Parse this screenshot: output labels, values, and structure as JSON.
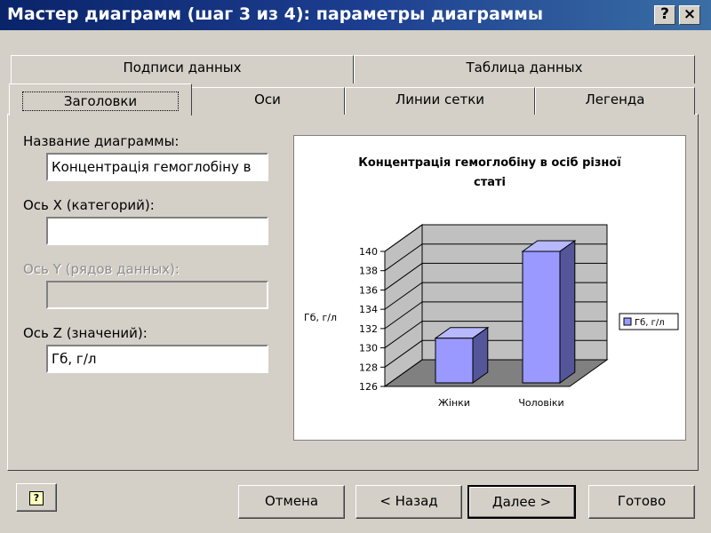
{
  "window": {
    "title": "Мастер диаграмм (шаг 3 из 4): параметры диаграммы",
    "help_label": "?",
    "close_label": "×",
    "title_color": "#0a246a"
  },
  "tabs": {
    "back_row": [
      {
        "label": "Подписи данных"
      },
      {
        "label": "Таблица данных"
      }
    ],
    "front_row": [
      {
        "label": "Заголовки",
        "active": true
      },
      {
        "label": "Оси"
      },
      {
        "label": "Линии сетки"
      },
      {
        "label": "Легенда"
      }
    ]
  },
  "form": {
    "chart_title_label": "Название диаграммы:",
    "chart_title_value": "Концентрація гемоглобіну в",
    "x_axis_label": "Ось X (категорий):",
    "x_axis_value": "",
    "y_axis_label": "Ось Y (рядов данных):",
    "y_axis_value": "",
    "z_axis_label": "Ось Z (значений):",
    "z_axis_value": "Гб, г/л"
  },
  "preview": {
    "title_line1": "Концентрація гемоглобіну в осіб різної",
    "title_line2": "статі",
    "z_axis_title": "Гб, г/л",
    "legend_label": "Гб, г/л",
    "bar_color": "#9999ff"
  },
  "chart_data": {
    "type": "bar",
    "title": "Концентрація гемоглобіну в осіб різної статі",
    "categories": [
      "Жінки",
      "Чоловіки"
    ],
    "series": [
      {
        "name": "Гб, г/л",
        "values": [
          131,
          140
        ]
      }
    ],
    "ylabel": "Гб, г/л",
    "ylim": [
      126,
      140
    ],
    "yticks": [
      126,
      128,
      130,
      132,
      134,
      136,
      138,
      140
    ],
    "grid": true,
    "legend": "right"
  },
  "buttons": {
    "help_icon_label": "?",
    "cancel": "Отмена",
    "back": "< Назад",
    "next": "Далее >",
    "finish": "Готово"
  }
}
